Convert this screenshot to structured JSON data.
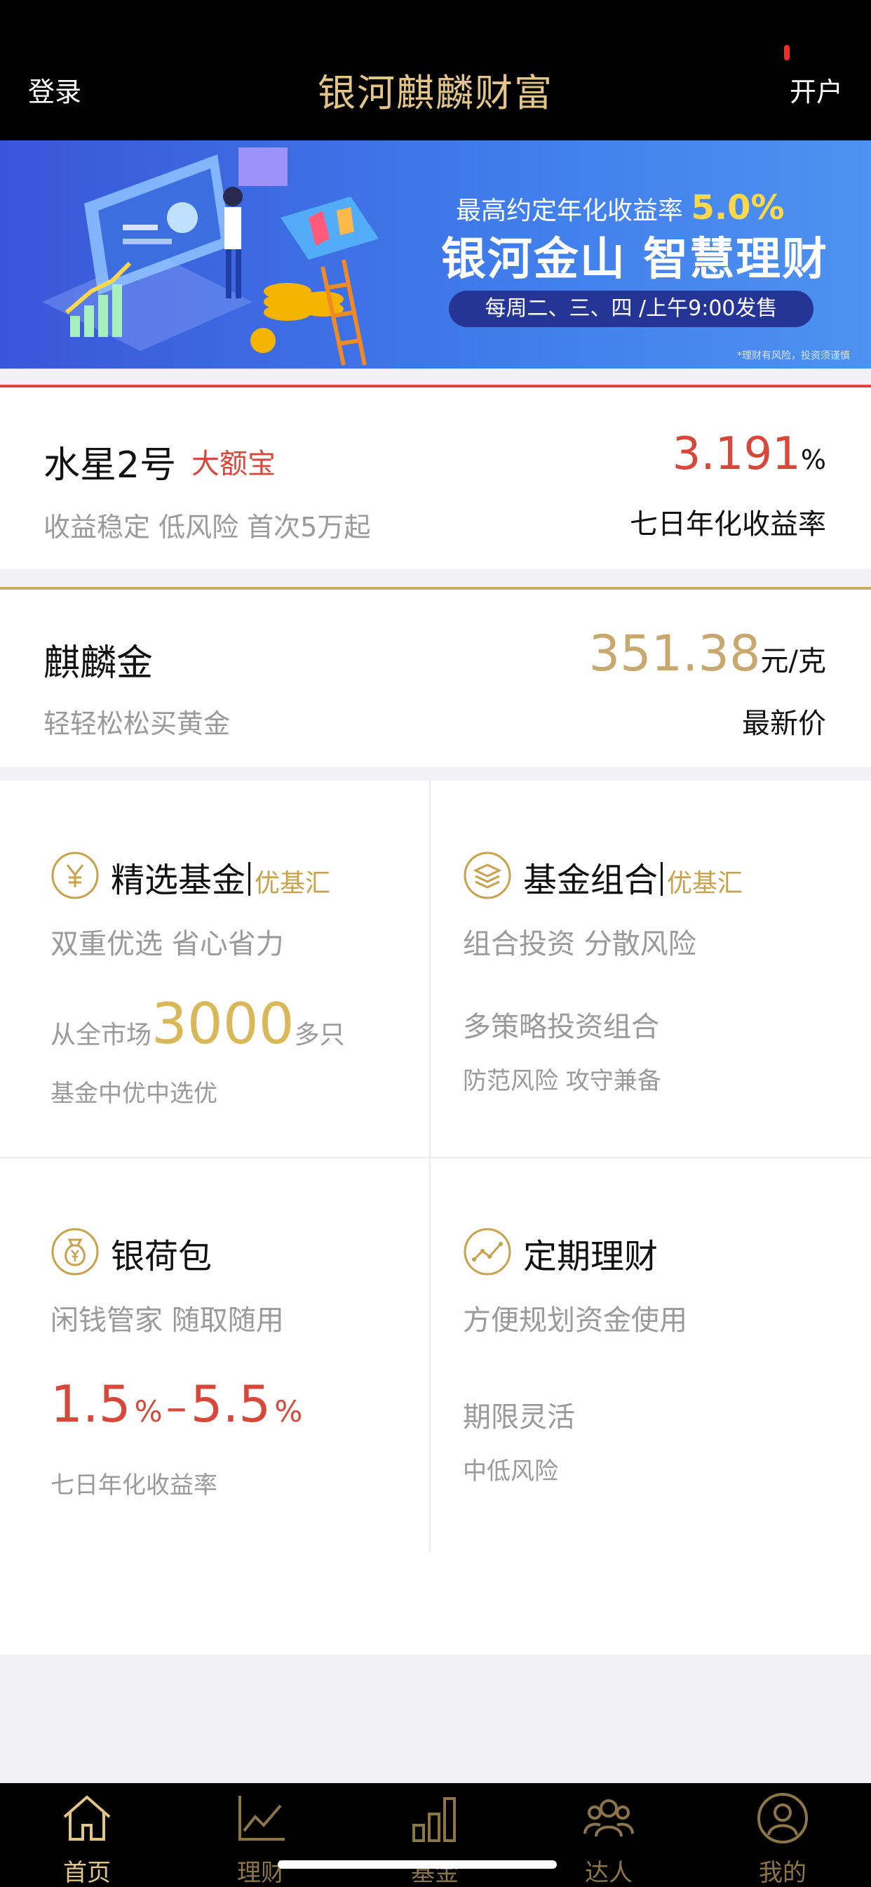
{
  "header": {
    "login": "登录",
    "title": "银河麒麟财富",
    "open_account": "开户"
  },
  "banner": {
    "line1": "最高约定年化收益率",
    "rate": "5.0%",
    "line2": "银河金山 智慧理财",
    "line3": "每周二、三、四 /上午9:00发售",
    "note": "*理财有风险，投资须谨慎"
  },
  "product1": {
    "name": "水星2号",
    "tag": "大额宝",
    "desc": "收益稳定 低风险 首次5万起",
    "value": "3.191",
    "unit": "%",
    "sub": "七日年化收益率"
  },
  "product2": {
    "name": "麒麟金",
    "desc": "轻轻松松买黄金",
    "value": "351.38",
    "unit": "元/克",
    "sub": "最新价"
  },
  "grid": {
    "fund": {
      "name": "精选基金",
      "tag": "优基汇",
      "line1": "双重优选 省心省力",
      "prefix": "从全市场",
      "number": "3000",
      "suffix": "多只",
      "line3": "基金中优中选优"
    },
    "portfolio": {
      "name": "基金组合",
      "tag": "优基汇",
      "line1": "组合投资 分散风险",
      "line2": "多策略投资组合",
      "line3": "防范风险 攻守兼备"
    },
    "wallet": {
      "name": "银荷包",
      "line1": "闲钱管家 随取随用",
      "low": "1.5",
      "high": "5.5",
      "pct": "%",
      "dash": "–",
      "line3": "七日年化收益率"
    },
    "fixed": {
      "name": "定期理财",
      "line1": "方便规划资金使用",
      "line2": "期限灵活",
      "line3": "中低风险"
    }
  },
  "tabs": [
    {
      "label": "首页",
      "icon": "home-icon",
      "active": true
    },
    {
      "label": "理财",
      "icon": "chart-line-icon",
      "active": false
    },
    {
      "label": "基金",
      "icon": "bar-chart-icon",
      "active": false
    },
    {
      "label": "达人",
      "icon": "people-icon",
      "active": false
    },
    {
      "label": "我的",
      "icon": "profile-icon",
      "active": false
    }
  ],
  "colors": {
    "gold": "#e3c58a",
    "red": "#d8483a",
    "header_bg": "#000000"
  }
}
